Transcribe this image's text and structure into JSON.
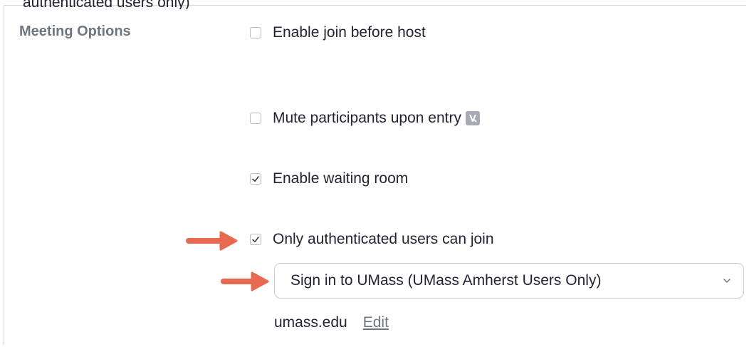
{
  "top_fragment": "authenticated users only)",
  "section": {
    "label": "Meeting Options"
  },
  "options": [
    {
      "label": "Enable join before host",
      "checked": false
    },
    {
      "label": "Mute participants upon entry",
      "checked": false,
      "has_lock_icon": true
    },
    {
      "label": "Enable waiting room",
      "checked": true
    },
    {
      "label": "Only authenticated users can join",
      "checked": true
    }
  ],
  "auth_select": {
    "value": "Sign in to UMass (UMass Amherst Users Only)"
  },
  "domain": {
    "text": "umass.edu",
    "edit_label": "Edit"
  },
  "colors": {
    "arrow": "#e8694f",
    "label_gray": "#6e7680",
    "text": "#232333",
    "border": "#c9ccd2"
  }
}
